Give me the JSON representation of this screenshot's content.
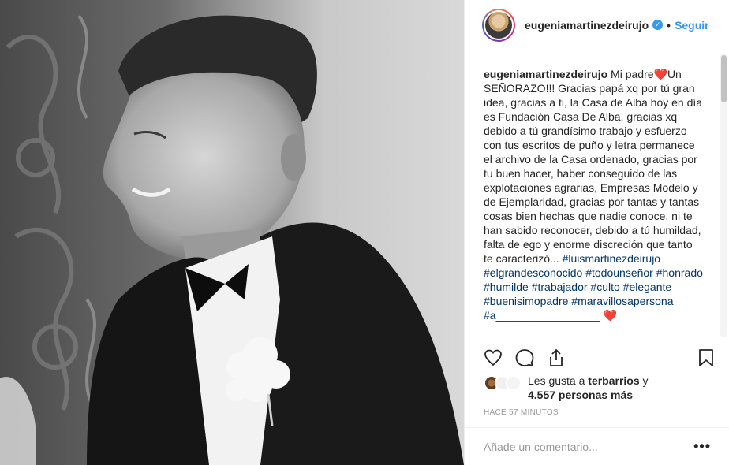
{
  "post": {
    "username": "eugeniamartinezdeirujo",
    "verified": true,
    "separator": "•",
    "follow_label": "Seguir"
  },
  "caption": {
    "username": "eugeniamartinezdeirujo",
    "text": " Mi padre❤️Un SEÑORAZO!!! Gracias papá xq por tú gran idea, gracias a ti, la Casa de Alba hoy en día es Fundación Casa De Alba, gracias xq debido a tú grandísimo trabajo y esfuerzo con tus escritos de puño y letra permanece el archivo de la Casa ordenado, gracias por tu buen hacer, haber conseguido de las explotaciones agrarias, Empresas Modelo y de Ejemplaridad, gracias por tantas y tantas cosas bien hechas que nadie conoce, ni te han sabido reconocer, debido a tú humildad, falta de ego y enorme discreción que tanto te caracterizó...",
    "hashtags": "#luismartinezdeirujo #elgrandesconocido #todounseñor #honrado #humilde #trabajador #culto #elegante #buenisimopadre #maravillosapersona #a_________________ ❤️"
  },
  "actions": {
    "like_icon": "heart-icon",
    "comment_icon": "comment-icon",
    "share_icon": "share-icon",
    "save_icon": "bookmark-icon"
  },
  "likes": {
    "prefix": "Les gusta a ",
    "user": "terbarrios",
    "conj": " y",
    "count": "4.557 personas más"
  },
  "timestamp": "HACE 57 MINUTOS",
  "comment": {
    "placeholder": "Añade un comentario...",
    "more_label": "•••"
  },
  "colors": {
    "accent": "#3897f0",
    "hashtag": "#003569",
    "muted": "#999999"
  }
}
